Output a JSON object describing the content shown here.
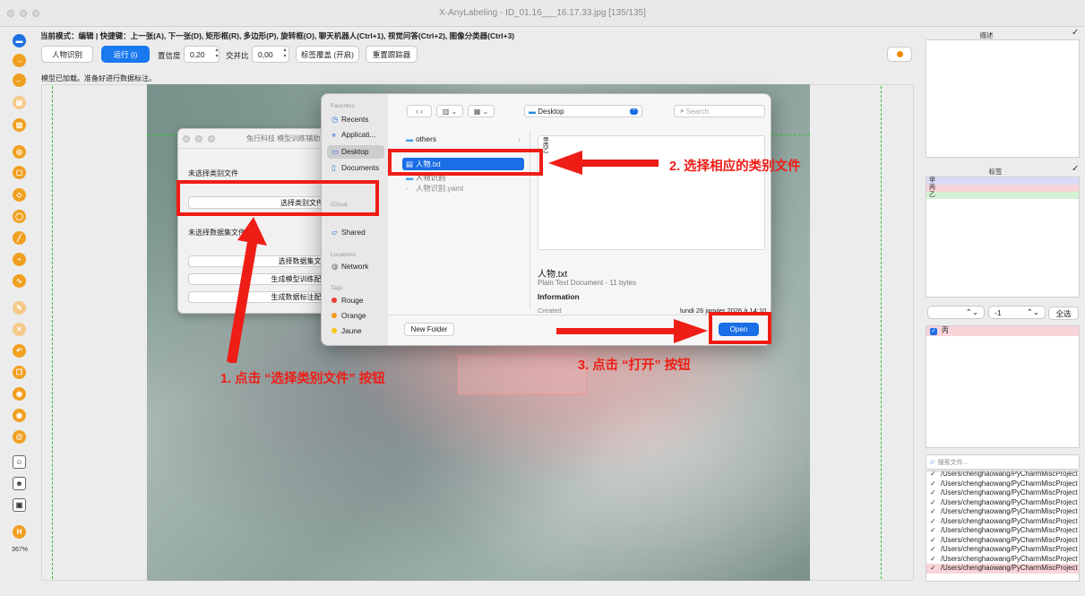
{
  "window": {
    "title": "X-AnyLabeling - ID_01.16___16.17.33.jpg [135/135]"
  },
  "mode_line": "当前模式：编辑 | 快捷键：上一张(A), 下一张(D), 矩形框(R), 多边形(P), 旋转框(O), 聊天机器人(Ctrl+1), 视觉问答(Ctrl+2), 图像分类器(Ctrl+3)",
  "toolbar": {
    "model_button": "人物识别",
    "run_button": "运行 (i)",
    "confidence_label": "置信度",
    "confidence_value": "0,20",
    "iou_label": "交并比",
    "iou_value": "0,00",
    "label_overwrite_button": "标签覆盖 (开启)",
    "reset_tracker_button": "重置跟踪器"
  },
  "status_message": "模型已加载。准备好进行数据标注。",
  "zoom_level": "367%",
  "right_panel": {
    "description_title": "描述",
    "labels_title": "标签",
    "labels": [
      {
        "name": "甲",
        "color": "#d9dcf7"
      },
      {
        "name": "丙",
        "color": "#f9d4d8"
      },
      {
        "name": "乙",
        "color": "#d6f2d6"
      }
    ],
    "group_value": "-1",
    "select_all_button": "全选",
    "shapes": [
      {
        "name": "丙",
        "checked": true,
        "color": "#f9d4d8"
      }
    ],
    "search_placeholder": "搜索文件...",
    "files": [
      "/Users/chenghaowang/PyCharmMiscProject",
      "/Users/chenghaowang/PyCharmMiscProject",
      "/Users/chenghaowang/PyCharmMiscProject",
      "/Users/chenghaowang/PyCharmMiscProject",
      "/Users/chenghaowang/PyCharmMiscProject",
      "/Users/chenghaowang/PyCharmMiscProject",
      "/Users/chenghaowang/PyCharmMiscProject",
      "/Users/chenghaowang/PyCharmMiscProject",
      "/Users/chenghaowang/PyCharmMiscProject",
      "/Users/chenghaowang/PyCharmMiscProject",
      "/Users/chenghaowang/PyCharmMiscProject"
    ]
  },
  "assist_dialog": {
    "title": "兔行科技 模型训练辅助",
    "no_class_file": "未选择类别文件",
    "select_class_button": "选择类别文件 (txt)",
    "no_dataset_folder": "未选择数据集文件夹",
    "select_dataset_button": "选择数据集文件夹",
    "gen_train_config_button": "生成模型训练配置文件",
    "gen_label_config_button": "生成数据标注配置文件"
  },
  "file_chooser": {
    "sidebar": {
      "favorites_header": "Favorites",
      "favorites": [
        "Recents",
        "Applicati...",
        "Desktop",
        "Documents"
      ],
      "icloud_header": "iCloud",
      "shared": "Shared",
      "locations_header": "Locations",
      "network": "Network",
      "tags_header": "Tags",
      "tags": [
        {
          "name": "Rouge",
          "color": "#ee3b30"
        },
        {
          "name": "Orange",
          "color": "#f59a1b"
        },
        {
          "name": "Jaune",
          "color": "#f5c518"
        }
      ]
    },
    "location": "Desktop",
    "search_placeholder": "Search",
    "files": [
      "others",
      "人物.txt",
      "人物识别",
      "人物识别.yaml"
    ],
    "preview_text": "甲\n丙\n乙",
    "selected_name": "人物.txt",
    "selected_kind": "Plain Text Document - 11 bytes",
    "info_header": "Information",
    "created_label": "Created",
    "created_value": "lundi 26 janvier 2026 à 14:10",
    "new_folder_button": "New Folder",
    "open_button": "Open"
  },
  "annotations": {
    "step1": "1. 点击 “选择类别文件” 按钮",
    "step2": "2. 选择相应的类别文件",
    "step3": "3. 点击 “打开” 按钮",
    "color": "#ee1d16"
  }
}
